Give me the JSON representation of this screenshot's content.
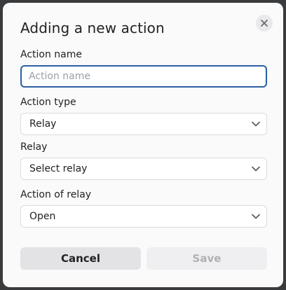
{
  "dialog": {
    "title": "Adding a new action",
    "close_icon": "close-icon"
  },
  "form": {
    "action_name": {
      "label": "Action name",
      "value": "",
      "placeholder": "Action name"
    },
    "action_type": {
      "label": "Action type",
      "value": "Relay"
    },
    "relay": {
      "label": "Relay",
      "value": "Select relay"
    },
    "action_of_relay": {
      "label": "Action of relay",
      "value": "Open"
    }
  },
  "buttons": {
    "cancel_label": "Cancel",
    "save_label": "Save",
    "save_disabled": true
  },
  "icons": {
    "dropdown": "chevron-down-icon"
  },
  "colors": {
    "focus_border": "#2b5fa3",
    "dialog_bg": "#fafafa",
    "overlay_bg": "#3a3b3d"
  }
}
